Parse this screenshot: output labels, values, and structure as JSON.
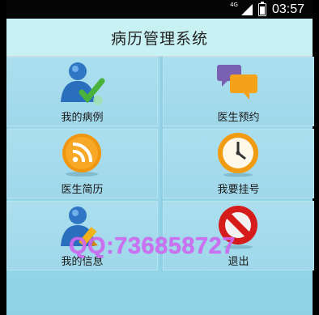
{
  "status_bar": {
    "network": "4G",
    "time": "03:57"
  },
  "header": {
    "title": "病历管理系统"
  },
  "menu": [
    {
      "label": "我的病例",
      "icon": "user-check-icon"
    },
    {
      "label": "医生预约",
      "icon": "chat-bubbles-icon"
    },
    {
      "label": "医生简历",
      "icon": "rss-icon"
    },
    {
      "label": "我要挂号",
      "icon": "clock-icon"
    },
    {
      "label": "我的信息",
      "icon": "user-edit-icon"
    },
    {
      "label": "退出",
      "icon": "prohibited-icon"
    }
  ],
  "watermark": "QQ:736858727",
  "colors": {
    "background": "#9fd7ea",
    "title_bar": "#c8f1f3",
    "watermark": "#cf68f1"
  }
}
